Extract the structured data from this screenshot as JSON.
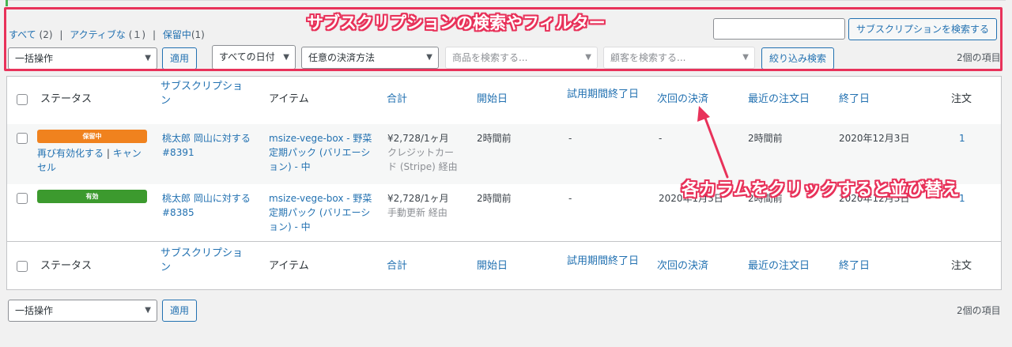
{
  "annotations": {
    "filter_title": "サブスクリプションの検索やフィルター",
    "sort_hint": "各カラムをクリックすると並び替え"
  },
  "views": {
    "all_label": "すべて",
    "all_count": "(2)",
    "active_label": "アクティブな",
    "active_count": "(１)",
    "onhold_label": "保留中",
    "onhold_count": "(1)",
    "sep": "|"
  },
  "search": {
    "button_label": "サブスクリプションを検索する"
  },
  "toolbar_top": {
    "bulk_action": "一括操作",
    "apply_label": "適用",
    "date_filter": "すべての日付",
    "payment_filter": "任意の決済方法",
    "product_placeholder": "商品を検索する...",
    "customer_placeholder": "顧客を検索する...",
    "filter_button": "絞り込み検索",
    "items_count": "2個の項目"
  },
  "columns": {
    "status": "ステータス",
    "subscription_l1": "サブスクリプショ",
    "subscription_l2": "ン",
    "item": "アイテム",
    "total": "合計",
    "start_date": "開始日",
    "trial_end": "試用期間終了日",
    "next_payment": "次回の決済",
    "last_order": "最近の注文日",
    "end_date": "終了日",
    "orders": "注文"
  },
  "rows": [
    {
      "status_badge": "保留中",
      "status_color": "#f0821e",
      "action_reactivate": "再び有効化する",
      "action_sep": " | ",
      "action_cancel_l1": "キャン",
      "action_cancel_l2": "セル",
      "customer_line": "桃太郎 岡山に対する",
      "order_id": "#8391",
      "item_l1": "msize-vege-box - 野菜",
      "item_l2": "定期パック (バリエーシ",
      "item_l3": "ョン) - 中",
      "total": "¥2,728/1ヶ月",
      "payment_l1": "クレジットカー",
      "payment_l2": "ド (Stripe) 経由",
      "start": "2時間前",
      "trial_end": "-",
      "next_payment": "-",
      "last_order": "2時間前",
      "end_date": "2020年12月3日",
      "orders": "1"
    },
    {
      "status_badge": "有効",
      "status_color": "#3c9a2e",
      "customer_line": "桃太郎 岡山に対する",
      "order_id": "#8385",
      "item_l1": "msize-vege-box - 野菜",
      "item_l2": "定期パック (バリエーシ",
      "item_l3": "ョン) - 中",
      "total": "¥2,728/1ヶ月",
      "payment_l1": "手動更新 経由",
      "start": "2時間前",
      "trial_end": "-",
      "next_payment": "2020年1月3日",
      "last_order": "2時間前",
      "end_date": "2020年12月3日",
      "orders": "1"
    }
  ],
  "toolbar_bottom": {
    "bulk_action": "一括操作",
    "apply_label": "適用",
    "items_count": "2個の項目"
  },
  "colors": {
    "accent": "#2271b1",
    "annotation": "#e8325a"
  }
}
